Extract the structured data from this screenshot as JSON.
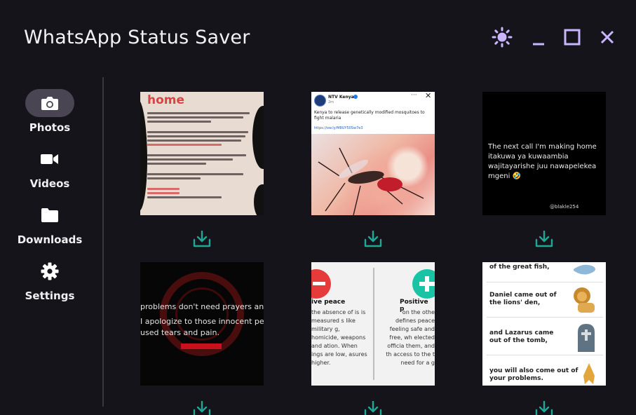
{
  "app": {
    "title": "WhatsApp Status Saver"
  },
  "window_controls": {
    "theme": "sun-icon",
    "minimize": "minimize-icon",
    "maximize": "maximize-icon",
    "close": "close-icon",
    "accent_color": "#c9b6ff"
  },
  "sidebar": {
    "items": [
      {
        "label": "Photos",
        "icon": "camera-icon",
        "active": true
      },
      {
        "label": "Videos",
        "icon": "video-camera-icon",
        "active": false
      },
      {
        "label": "Downloads",
        "icon": "folder-icon",
        "active": false
      },
      {
        "label": "Settings",
        "icon": "gear-icon",
        "active": false
      }
    ],
    "active_bg": "#4a4553"
  },
  "statuses": {
    "download_icon": "download-icon",
    "download_color": "#1fa896",
    "items": [
      {
        "heading": "home",
        "body_lines": [
          "Dear Ruto Odinga, your decision today, to stand with our oppressors validates our choice for not wanting you involved in our protests from the beginning.",
          "For the past few weeks we have fought for our rights as Kenyans online and in the streets. Dozens of Kenyans have been abducted, tortured and killed. This was not in vain. We will not dialogue with our oppressors.",
          "We will NOT allow you to hijack our movement to satisfy your political greed.",
          "We will drain this swamp with you in it. This is not business as usual.",
          "We are partyless",
          "We are tribeless",
          "And most importantly WE ARE LEADERLESS"
        ]
      },
      {
        "account": "NTV Kenya",
        "time": "2m",
        "caption": "Kenya to release genetically modified mosquitoes to fight malaria",
        "link": "https://ow.ly/M8UY50Sw7e3"
      },
      {
        "text": "The next call I'm making home itakuwa ya kuwaambia wajitayarishe juu nawapelekea mgeni 🤣",
        "handle": "@blakle254"
      },
      {
        "lines": [
          "problems don't need prayers and",
          "I apologize to those innocent peop",
          "used tears and pain."
        ]
      },
      {
        "left_heading": "ive peace",
        "left_body": "the absence of is is measured s like military g, homicide, weapons and ation. When ings are low, asures higher.",
        "right_heading": "Positive p",
        "right_body": "on the othe defines peace feeling safe and free, wh elected officia them, and th access to the t need for a g"
      },
      {
        "rows": [
          "of the great fish,",
          "Daniel came out of the lions' den,",
          "and Lazarus came out of the tomb,",
          "you will also come out of your problems."
        ]
      }
    ]
  }
}
